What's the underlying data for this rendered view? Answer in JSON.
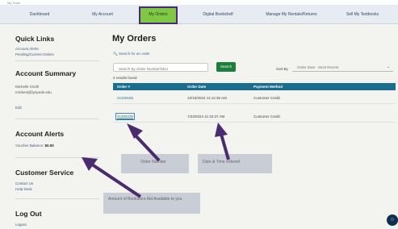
{
  "top_strip": "My Tools",
  "nav": {
    "items": [
      {
        "label": "Dashboard"
      },
      {
        "label": "My Account"
      },
      {
        "label": "My Orders",
        "active": true
      },
      {
        "label": "Digital Bookshelf"
      },
      {
        "label": "Manage My Rentals/Returns"
      },
      {
        "label": "Sell My Textbooks"
      }
    ]
  },
  "sidebar": {
    "quick_links": {
      "title": "Quick Links",
      "links": [
        "Account Alerts",
        "Pending/Current Orders"
      ]
    },
    "account_summary": {
      "title": "Account Summary",
      "name": "Michelle Smith",
      "email": "mmbest@lynpeds.edu",
      "edit": "Edit"
    },
    "account_alerts": {
      "title": "Account Alerts",
      "alert_text": "Voucher Balance:",
      "alert_amount": "$0.00"
    },
    "customer_service": {
      "title": "Customer Service",
      "links": [
        "Contact Us",
        "Help Desk"
      ]
    },
    "logout": {
      "title": "Log Out",
      "link": "Logout"
    }
  },
  "main": {
    "title": "My Orders",
    "search_link": "Search for an order",
    "search_placeholder": "Search By Order Number/SKU",
    "search_button": "Search",
    "sort_label": "Sort By",
    "sort_value": "Order Date - Most Recent",
    "results_text": "2 results found",
    "table": {
      "headers": [
        "Order #",
        "Order Date",
        "Payment Method"
      ],
      "rows": [
        {
          "order": "21329185",
          "date": "10/15/2024 11:12:35 AM",
          "payment": "Customer Credit"
        },
        {
          "order": "21305236",
          "date": "7/23/2024 11:34:37 AM",
          "payment": "Customer Credit"
        }
      ]
    }
  },
  "annotations": {
    "order_number": "Order Number",
    "date_time": "Date & Time ordered",
    "voucher": "Amount of Bookstore Aid Available to you"
  },
  "colors": {
    "active_tab": "#7ec846",
    "active_outline": "#4a2b6f",
    "table_header": "#1a6d8c",
    "search_button": "#1e7e3c",
    "arrow": "#4a2b6f"
  }
}
